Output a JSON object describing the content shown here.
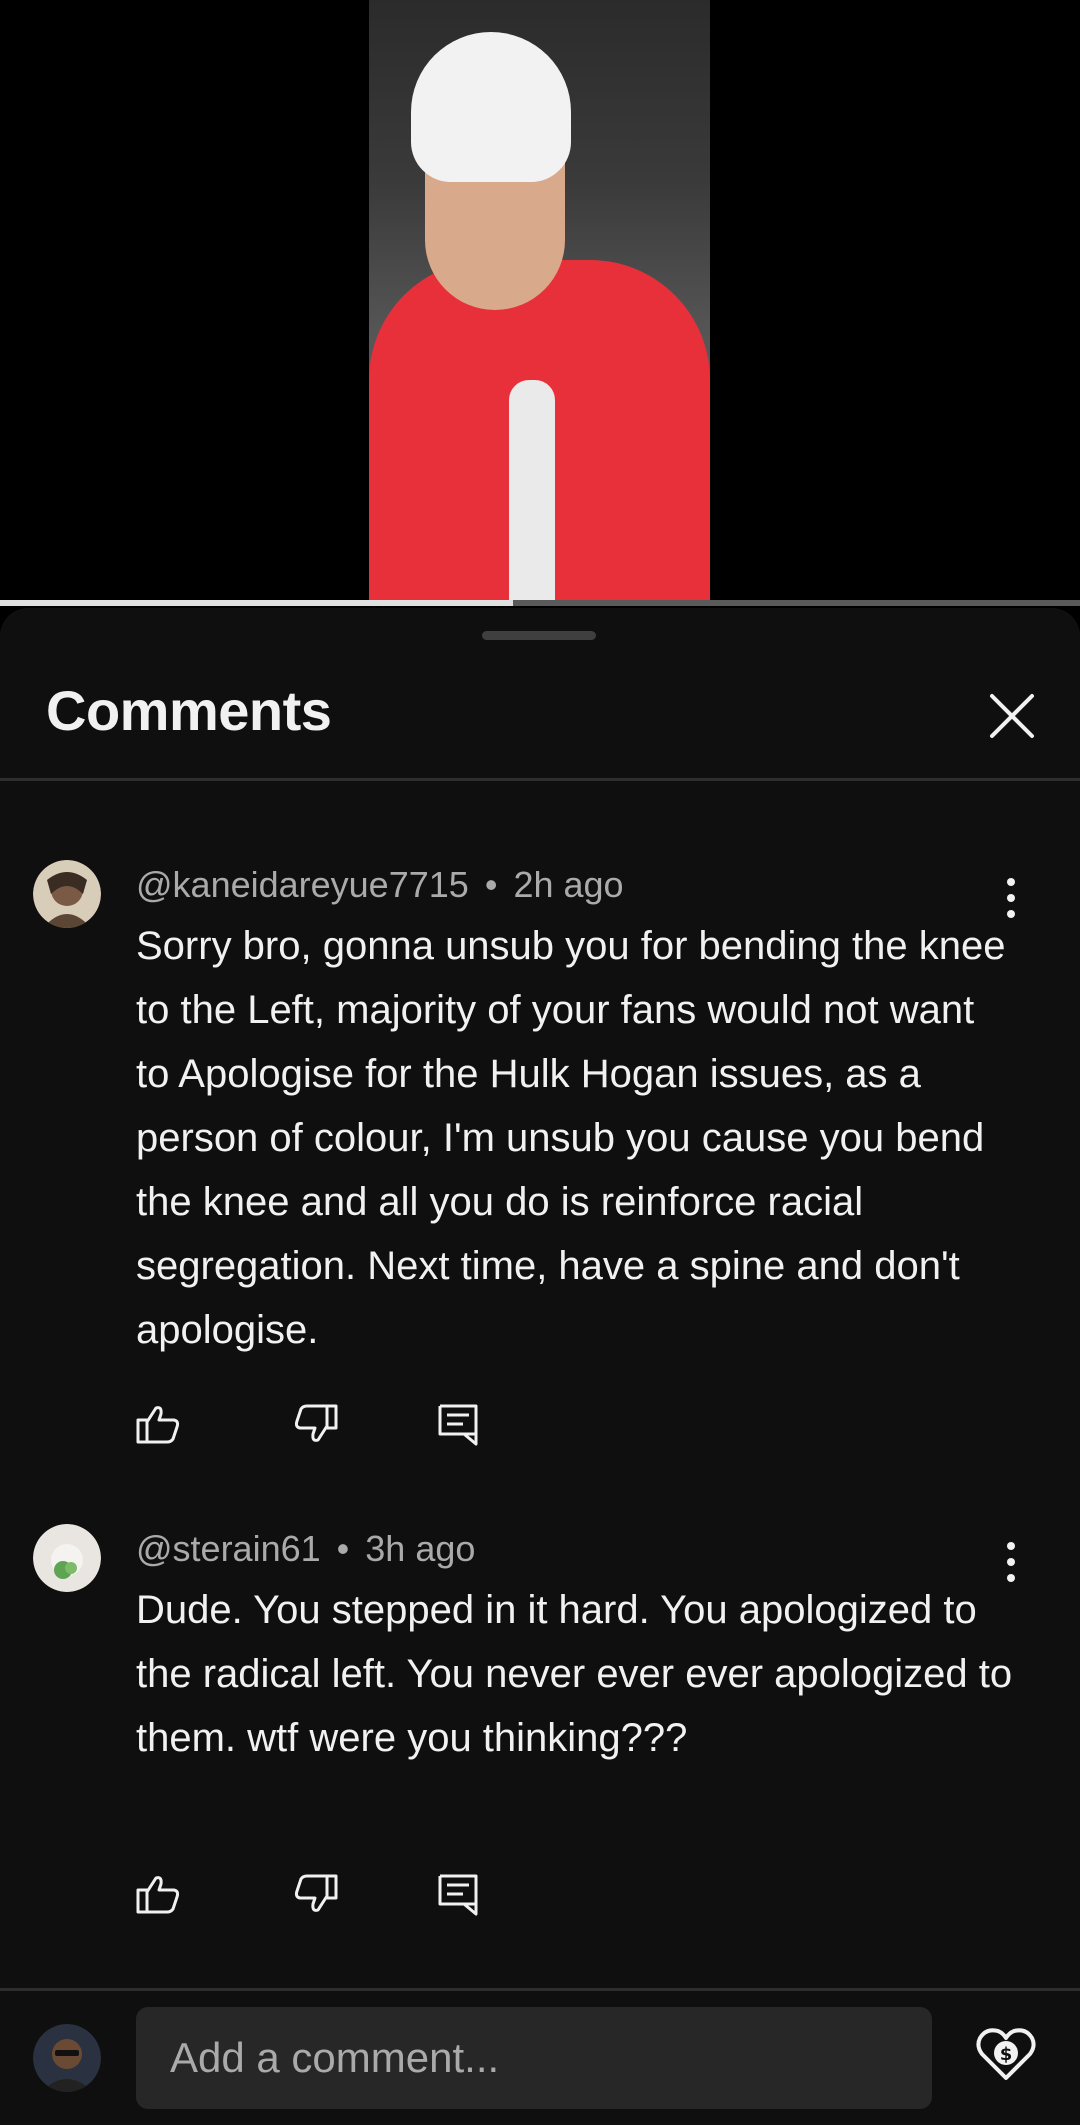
{
  "video": {
    "progress": 0.475
  },
  "comments_panel": {
    "title": "Comments",
    "close_icon": "close-icon"
  },
  "comments": [
    {
      "author": "@kaneidareyue7715",
      "separator": "•",
      "time": "2h ago",
      "text": "Sorry bro, gonna unsub you for bending the knee to the Left, majority of your fans would not want to Apologise for the Hulk Hogan issues, as a person of colour, I'm unsub you cause you bend the knee and all you do is reinforce racial segregation. Next time, have a spine and don't apologise.",
      "icons": [
        "thumbs-up-icon",
        "thumbs-down-icon",
        "reply-icon",
        "more-vert-icon"
      ]
    },
    {
      "author": "@sterain61",
      "separator": "•",
      "time": "3h ago",
      "text": "Dude. You stepped in it hard. You apologized to the radical left. You never ever ever apologized to them. wtf were you thinking???",
      "icons": [
        "thumbs-up-icon",
        "thumbs-down-icon",
        "reply-icon",
        "more-vert-icon"
      ]
    }
  ],
  "composer": {
    "placeholder": "Add a comment...",
    "value": "",
    "thanks_icon": "super-thanks-heart-dollar-icon"
  },
  "colors": {
    "background": "#0f0f0f",
    "text": "#f1f1f1",
    "secondary_text": "#aaaaaa",
    "input_background": "#272727",
    "hoodie_red": "#e8303a"
  }
}
